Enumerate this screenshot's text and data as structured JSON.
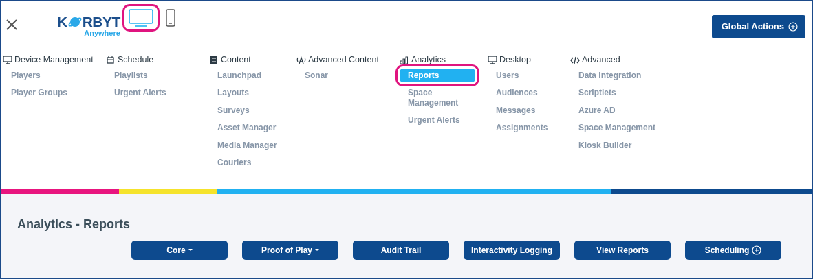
{
  "header": {
    "logo": {
      "left": "K",
      "right": "RBYT",
      "tagline": "Anywhere"
    },
    "view_toggles": [
      {
        "kind": "desktop",
        "selected": true,
        "highlighted": true
      },
      {
        "kind": "mobile",
        "selected": false,
        "highlighted": false
      }
    ],
    "global_actions": "Global Actions"
  },
  "menu": [
    {
      "title": "Device Management",
      "kind": "monitor",
      "items": [
        {
          "label": "Players",
          "selected": false,
          "highlighted": false
        },
        {
          "label": "Player Groups",
          "selected": false,
          "highlighted": false
        }
      ]
    },
    {
      "title": "Schedule",
      "kind": "calendar",
      "items": [
        {
          "label": "Playlists",
          "selected": false,
          "highlighted": false
        },
        {
          "label": "Urgent Alerts",
          "selected": false,
          "highlighted": false
        }
      ]
    },
    {
      "title": "Content",
      "kind": "document",
      "items": [
        {
          "label": "Launchpad",
          "selected": false,
          "highlighted": false
        },
        {
          "label": "Layouts",
          "selected": false,
          "highlighted": false
        },
        {
          "label": "Surveys",
          "selected": false,
          "highlighted": false
        },
        {
          "label": "Asset Manager",
          "selected": false,
          "highlighted": false
        },
        {
          "label": "Media Manager",
          "selected": false,
          "highlighted": false
        },
        {
          "label": "Couriers",
          "selected": false,
          "highlighted": false
        }
      ]
    },
    {
      "title": "Advanced Content",
      "kind": "antenna",
      "items": [
        {
          "label": "Sonar",
          "selected": false,
          "highlighted": false
        }
      ]
    },
    {
      "title": "Analytics",
      "kind": "bars",
      "items": [
        {
          "label": "Reports",
          "selected": true,
          "highlighted": true
        },
        {
          "label": "Space Management",
          "selected": false,
          "highlighted": false
        },
        {
          "label": "Urgent Alerts",
          "selected": false,
          "highlighted": false
        }
      ]
    },
    {
      "title": "Desktop",
      "kind": "monitor",
      "items": [
        {
          "label": "Users",
          "selected": false,
          "highlighted": false
        },
        {
          "label": "Audiences",
          "selected": false,
          "highlighted": false
        },
        {
          "label": "Messages",
          "selected": false,
          "highlighted": false
        },
        {
          "label": "Assignments",
          "selected": false,
          "highlighted": false
        }
      ]
    },
    {
      "title": "Advanced",
      "kind": "code",
      "items": [
        {
          "label": "Data Integration",
          "selected": false,
          "highlighted": false
        },
        {
          "label": "Scriptlets",
          "selected": false,
          "highlighted": false
        },
        {
          "label": "Azure AD",
          "selected": false,
          "highlighted": false
        },
        {
          "label": "Space Management",
          "selected": false,
          "highlighted": false
        },
        {
          "label": "Kiosk Builder",
          "selected": false,
          "highlighted": false
        }
      ]
    }
  ],
  "page": {
    "title": "Analytics - Reports",
    "buttons": [
      {
        "label": "Core",
        "kind": "dropdown"
      },
      {
        "label": "Proof of Play",
        "kind": "dropdown"
      },
      {
        "label": "Audit Trail",
        "kind": "plain"
      },
      {
        "label": "Interactivity Logging",
        "kind": "plain"
      },
      {
        "label": "View Reports",
        "kind": "plain"
      },
      {
        "label": "Scheduling",
        "kind": "add"
      }
    ]
  }
}
